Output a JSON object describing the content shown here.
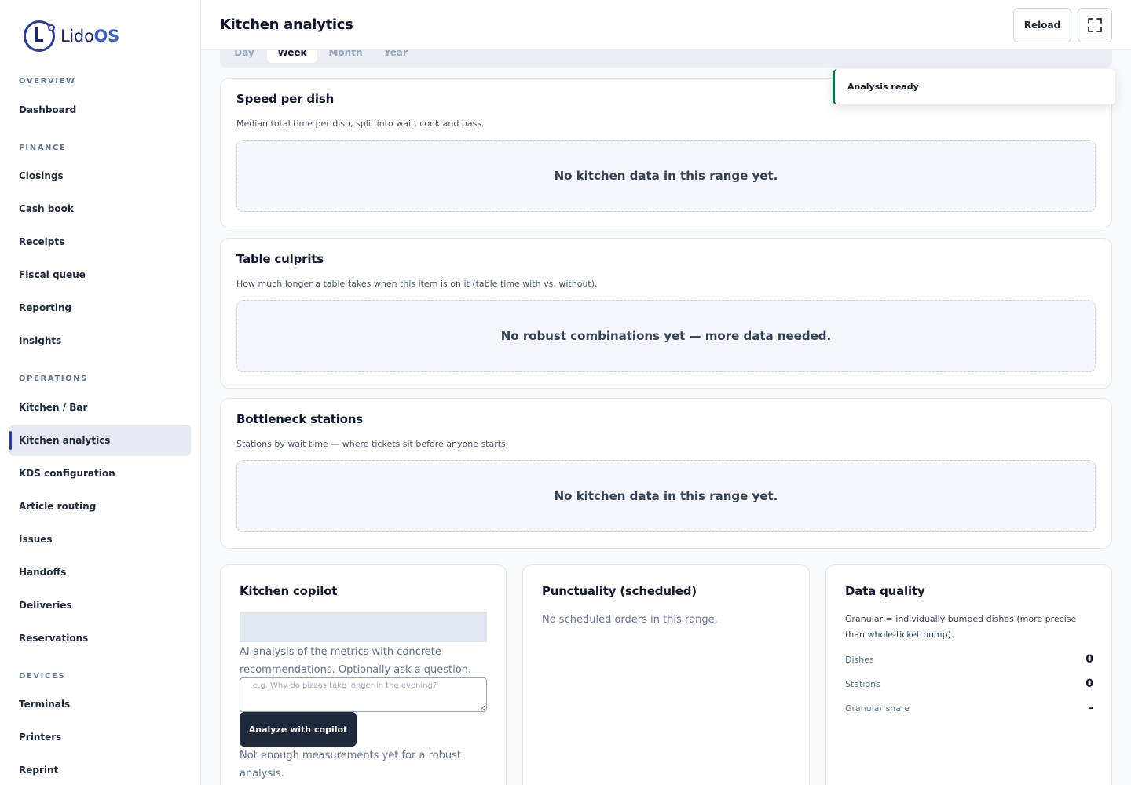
{
  "brand": {
    "name_light": "Lido",
    "name_bold": "OS"
  },
  "sidebar": {
    "sections": [
      {
        "title": "OVERVIEW",
        "items": [
          "Dashboard"
        ]
      },
      {
        "title": "FINANCE",
        "items": [
          "Closings",
          "Cash book",
          "Receipts",
          "Fiscal queue",
          "Reporting",
          "Insights"
        ]
      },
      {
        "title": "OPERATIONS",
        "items": [
          "Kitchen / Bar",
          "Kitchen analytics",
          "KDS configuration",
          "Article routing",
          "Issues",
          "Handoffs",
          "Deliveries",
          "Reservations"
        ]
      },
      {
        "title": "DEVICES",
        "items": [
          "Terminals",
          "Printers",
          "Reprint"
        ]
      }
    ],
    "active_item": "Kitchen analytics"
  },
  "header": {
    "title": "Kitchen analytics",
    "reload_label": "Reload",
    "fullscreen_icon": "expand-icon"
  },
  "range_tabs": {
    "items": [
      "Day",
      "Week",
      "Month",
      "Year"
    ],
    "selected": "Week"
  },
  "toast": {
    "message": "Analysis ready",
    "accent_color": "#166a4f"
  },
  "cards": {
    "speed": {
      "title": "Speed per dish",
      "subtitle": "Median total time per dish, split into wait, cook and pass.",
      "empty_text": "No kitchen data in this range yet."
    },
    "culprits": {
      "title": "Table culprits",
      "subtitle": "How much longer a table takes when this item is on it (table time with vs. without).",
      "empty_text": "No robust combinations yet — more data needed."
    },
    "bottleneck": {
      "title": "Bottleneck stations",
      "subtitle": "Stations by wait time — where tickets sit before anyone starts.",
      "empty_text": "No kitchen data in this range yet."
    }
  },
  "copilot": {
    "title": "Kitchen copilot",
    "description": "AI analysis of the metrics with concrete recommendations. Optionally ask a question.",
    "input_placeholder": "e.g. Why do pizzas take longer in the evening?",
    "analyze_label": "Analyze with copilot",
    "note": "Not enough measurements yet for a robust analysis."
  },
  "punctuality": {
    "title": "Punctuality (scheduled)",
    "empty_text": "No scheduled orders in this range."
  },
  "data_quality": {
    "title": "Data quality",
    "description": "Granular = individually bumped dishes (more precise than whole-ticket bump).",
    "rows": [
      {
        "label": "Dishes",
        "value": "0"
      },
      {
        "label": "Stations",
        "value": "0"
      },
      {
        "label": "Granular share",
        "value": "–"
      }
    ]
  },
  "colors": {
    "primary": "#2d3e8c",
    "brand_accent": "#3f62c6",
    "dark_button": "#1e293b",
    "active_nav_bg": "#e6e9f2"
  }
}
